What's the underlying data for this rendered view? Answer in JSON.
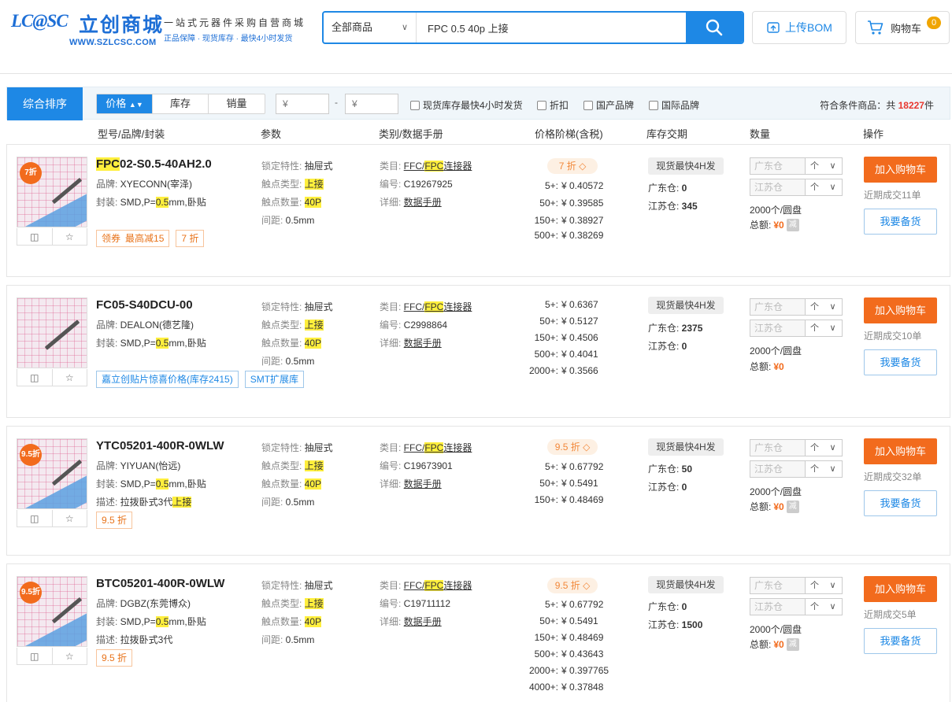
{
  "header": {
    "logo_badge": "LC@SC",
    "logo_cn": "立创商城",
    "logo_url": "WWW.SZLCSC.COM",
    "slogan_1": "一站式元器件采购自营商城",
    "slogan_2": "正品保障 · 现货库存 · 最快4小时发货",
    "search_category": "全部商品",
    "search_value": "FPC 0.5 40p 上接",
    "bom_label": "上传BOM",
    "cart_label": "购物车",
    "cart_count": "0"
  },
  "filters": {
    "sort_main": "综合排序",
    "sort_price": "价格",
    "sort_stock": "库存",
    "sort_sales": "销量",
    "price_min_placeholder": "¥",
    "price_max_placeholder": "¥",
    "price_sep": "-",
    "checkboxes": [
      "现货库存最快4小时发货",
      "折扣",
      "国产品牌",
      "国际品牌"
    ],
    "result_prefix": "符合条件商品：共",
    "result_count": "18227",
    "result_suffix": "件"
  },
  "columns": [
    "型号/品牌/封装",
    "参数",
    "类别/数据手册",
    "价格阶梯(含税)",
    "库存交期",
    "数量",
    "操作"
  ],
  "labels": {
    "brand": "品牌: ",
    "package": "封装: ",
    "desc": "描述: ",
    "lock": "锁定特性: ",
    "contact_type": "触点类型: ",
    "contact_count": "触点数量: ",
    "pitch": "间距: ",
    "category": "类目: ",
    "code": "编号: ",
    "detail": "详细: ",
    "datasheet": "数据手册",
    "stock_fast": "现货最快4H发",
    "gd": "广东仓: ",
    "js": "江苏仓: ",
    "gd_ph": "广东仓",
    "js_ph": "江苏仓",
    "total": "总额: ",
    "minus": "减",
    "add_cart": "加入购物车",
    "backorder": "我要备货",
    "up": "个",
    "down": "∨",
    "pkg_prefix": "SMD,P=",
    "pkg_hl": "0.5",
    "pkg_suffix": "mm,卧贴",
    "cat_pre": "FFC/",
    "cat_hl": "FPC",
    "cat_post": "连接器"
  },
  "products": [
    {
      "name_hl": "FPC",
      "name_rest": "02-S0.5-40AH2.0",
      "badge": "7折",
      "brand": "XYECONN(宰泽)",
      "desc": "",
      "lock": "抽屉式",
      "contact_type": "上接",
      "contact_count": "40P",
      "pitch": "0.5mm",
      "code": "C19267925",
      "discount": "7 折",
      "tiers": [
        [
          "5+:",
          "¥ 0.40572"
        ],
        [
          "50+:",
          "¥ 0.39585"
        ],
        [
          "150+:",
          "¥ 0.38927"
        ],
        [
          "500+:",
          "¥ 0.38269"
        ]
      ],
      "gd_stock": "0",
      "js_stock": "345",
      "per_reel": "2000个/圆盘",
      "total_amt": "¥0",
      "recent": "近期成交11单",
      "tag_coupon_label": "领券",
      "tag_coupon": "最高减15",
      "tag_disc": "7 折"
    },
    {
      "name_hl": "",
      "name_rest": "FC05-S40DCU-00",
      "badge": "",
      "brand": "DEALON(德艺隆)",
      "desc": "",
      "lock": "抽屉式",
      "contact_type": "上接",
      "contact_count": "40P",
      "pitch": "0.5mm",
      "code": "C2998864",
      "discount": "",
      "tiers": [
        [
          "5+:",
          "¥ 0.6367"
        ],
        [
          "50+:",
          "¥ 0.5127"
        ],
        [
          "150+:",
          "¥ 0.4506"
        ],
        [
          "500+:",
          "¥ 0.4041"
        ],
        [
          "2000+:",
          "¥ 0.3566"
        ]
      ],
      "gd_stock": "2375",
      "js_stock": "0",
      "per_reel": "2000个/圆盘",
      "total_amt": "¥0",
      "recent": "近期成交10单",
      "tag_smt": "嘉立创贴片惊喜价格(库存2415)",
      "tag_smt2": "SMT扩展库"
    },
    {
      "name_hl": "",
      "name_rest": "YTC05201-400R-0WLW",
      "badge": "9.5折",
      "brand": "YIYUAN(怡远)",
      "desc_pre": "拉拨卧式3代",
      "desc_hl": "上接",
      "lock": "抽屉式",
      "contact_type": "上接",
      "contact_count": "40P",
      "pitch": "0.5mm",
      "code": "C19673901",
      "discount": "9.5 折",
      "tiers": [
        [
          "5+:",
          "¥ 0.67792"
        ],
        [
          "50+:",
          "¥ 0.5491"
        ],
        [
          "150+:",
          "¥ 0.48469"
        ]
      ],
      "gd_stock": "50",
      "js_stock": "0",
      "per_reel": "2000个/圆盘",
      "total_amt": "¥0",
      "recent": "近期成交32单",
      "tag_disc": "9.5 折"
    },
    {
      "name_hl": "",
      "name_rest": "BTC05201-400R-0WLW",
      "badge": "9.5折",
      "brand": "DGBZ(东莞博众)",
      "desc_pre": "拉拨卧式3代",
      "desc_hl": "",
      "lock": "抽屉式",
      "contact_type": "上接",
      "contact_count": "40P",
      "pitch": "0.5mm",
      "code": "C19711112",
      "discount": "9.5 折",
      "tiers": [
        [
          "5+:",
          "¥ 0.67792"
        ],
        [
          "50+:",
          "¥ 0.5491"
        ],
        [
          "150+:",
          "¥ 0.48469"
        ],
        [
          "500+:",
          "¥ 0.43643"
        ],
        [
          "2000+:",
          "¥ 0.397765"
        ],
        [
          "4000+:",
          "¥ 0.37848"
        ]
      ],
      "gd_stock": "0",
      "js_stock": "1500",
      "per_reel": "2000个/圆盘",
      "total_amt": "¥0",
      "recent": "近期成交5单",
      "tag_disc": "9.5 折"
    }
  ]
}
